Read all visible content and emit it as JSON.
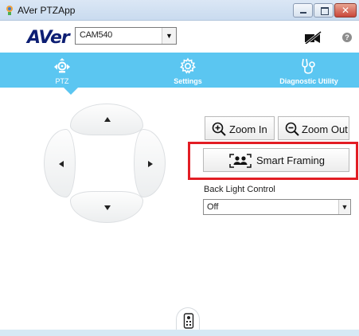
{
  "window": {
    "title": "AVer PTZApp"
  },
  "header": {
    "logo": "AVer",
    "camera_select": {
      "selected": "CAM540"
    },
    "help_glyph": "?"
  },
  "tabs": [
    {
      "label": "PTZ",
      "icon": "ptz-icon",
      "active": true
    },
    {
      "label": "Settings",
      "icon": "gear-icon",
      "active": false
    },
    {
      "label": "Diagnostic Utility",
      "icon": "stethoscope-icon",
      "active": false
    }
  ],
  "controls": {
    "zoom_in": "Zoom In",
    "zoom_out": "Zoom Out",
    "smart_framing": "Smart Framing",
    "back_light_label": "Back Light Control",
    "back_light_value": "Off"
  },
  "colors": {
    "accent": "#5bc6f1",
    "highlight": "#e21d24",
    "logo": "#0d1e73"
  }
}
